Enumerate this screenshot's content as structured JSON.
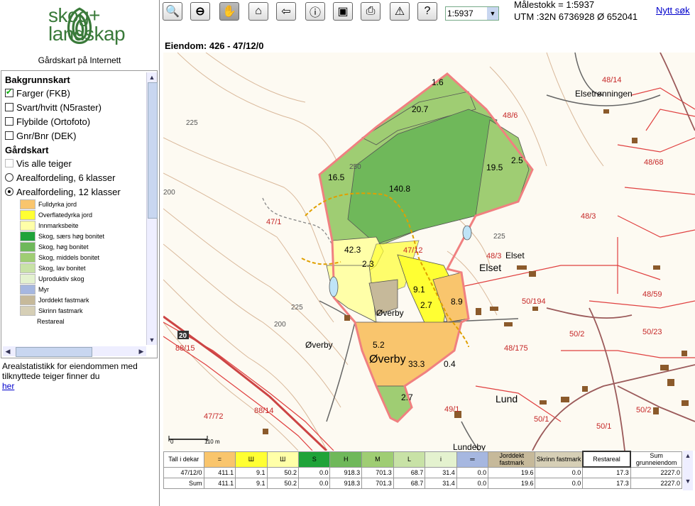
{
  "logo": {
    "line1": "skog+",
    "line2": "landskap"
  },
  "subtitle": "Gårdskart på Internett",
  "layers": {
    "bakgrunn_header": "Bakgrunnskart",
    "bakgrunn": [
      {
        "label": "Farger (FKB)",
        "checked": true
      },
      {
        "label": "Svart/hvitt (N5raster)",
        "checked": false
      },
      {
        "label": "Flybilde (Ortofoto)",
        "checked": false
      },
      {
        "label": "Gnr/Bnr (DEK)",
        "checked": false
      }
    ],
    "gardskart_header": "Gårdskart",
    "vis_alle": "Vis alle teiger",
    "radio": [
      {
        "label": "Arealfordeling, 6 klasser",
        "selected": false
      },
      {
        "label": "Arealfordeling, 12 klasser",
        "selected": true
      }
    ],
    "legend": [
      {
        "label": "Fulldyrka jord",
        "color": "#f9c56d"
      },
      {
        "label": "Overflatedyrka jord",
        "color": "#ffff33"
      },
      {
        "label": "Innmarksbeite",
        "color": "#ffffa8"
      },
      {
        "label": "Skog, særs høg bonitet",
        "color": "#1fa339"
      },
      {
        "label": "Skog, høg bonitet",
        "color": "#6fb85a"
      },
      {
        "label": "Skog, middels bonitet",
        "color": "#9fcd73"
      },
      {
        "label": "Skog, lav bonitet",
        "color": "#c8e2a6"
      },
      {
        "label": "Uproduktiv skog",
        "color": "#e4f2cf"
      },
      {
        "label": "Myr",
        "color": "#a6b7e0"
      },
      {
        "label": "Jorddekt fastmark",
        "color": "#c6b99a"
      },
      {
        "label": "Skrinn fastmark",
        "color": "#d6cfb6"
      },
      {
        "label": "Restareal",
        "color": "#ffffff"
      }
    ]
  },
  "stat_text": "Arealstatistikk for eiendommen med tilknyttede teiger finner du",
  "stat_link": "her",
  "toolbar": {
    "buttons": [
      "zoom-in-icon",
      "zoom-out-icon",
      "pan-icon",
      "home-icon",
      "back-icon",
      "info-icon",
      "save-icon",
      "print-icon",
      "warning-icon",
      "help-icon"
    ],
    "scale_value": "1:5937"
  },
  "maalestokk": "Målestokk = 1:5937",
  "utm": "UTM :32N 6736928 Ø 652041",
  "nytt_sok": "Nytt søk",
  "eiendom": "Eiendom: 426 - 47/12/0",
  "map": {
    "area_labels": [
      "1.6",
      "20.7",
      "16.5",
      "140.8",
      "19.5",
      "2.5",
      "42.3",
      "2.3",
      "9.1",
      "2.7",
      "8.9",
      "5.2",
      "33.3",
      "0.4",
      "2.7"
    ],
    "place_names": [
      "Elsetrønningen",
      "Elset",
      "Elset",
      "Øverby",
      "Øverby",
      "Øverby",
      "Lund",
      "Lundeby"
    ],
    "parcel_labels": [
      "48/14",
      "48/6",
      "48/68",
      "48/3",
      "48/3",
      "47/1",
      "47/12",
      "50/194",
      "48/59",
      "50/2",
      "50/23",
      "48/175",
      "88/15",
      "47/72",
      "88/14",
      "49/1",
      "50/1",
      "50/1",
      "50/2"
    ],
    "contour_labels": [
      "225",
      "250",
      "200",
      "225",
      "200",
      "225"
    ],
    "road_number": "20",
    "scalebar_left": "0",
    "scalebar_right": "110 m"
  },
  "table": {
    "headers": [
      "Tall i dekar",
      "=",
      "Ш",
      "Ш",
      "S",
      "H",
      "M",
      "L",
      "i",
      "═",
      "Jorddekt fastmark",
      "Skrinn fastmark",
      "Restareal",
      "Sum grunneiendom"
    ],
    "header_colors": [
      "#ffffff",
      "#f9c56d",
      "#ffff33",
      "#ffffa8",
      "#1fa339",
      "#6fb85a",
      "#9fcd73",
      "#c8e2a6",
      "#e4f2cf",
      "#a6b7e0",
      "#c6b99a",
      "#d6cfb6",
      "#ffffff",
      "#ffffff"
    ],
    "rows": [
      [
        "47/12/0",
        "411.1",
        "9.1",
        "50.2",
        "0.0",
        "918.3",
        "701.3",
        "68.7",
        "31.4",
        "0.0",
        "19.6",
        "0.0",
        "17.3",
        "2227.0"
      ],
      [
        "Sum",
        "411.1",
        "9.1",
        "50.2",
        "0.0",
        "918.3",
        "701.3",
        "68.7",
        "31.4",
        "0.0",
        "19.6",
        "0.0",
        "17.3",
        "2227.0"
      ]
    ]
  }
}
